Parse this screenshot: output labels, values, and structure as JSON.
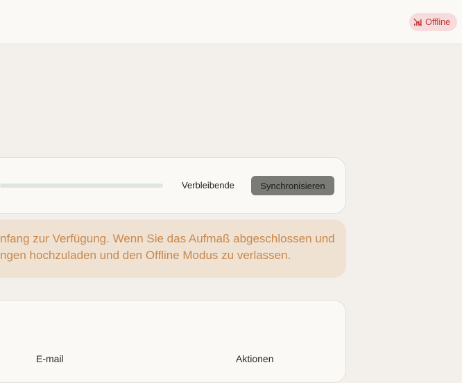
{
  "header": {
    "status_badge": {
      "label": "Offline",
      "icon": "signal-off-icon",
      "color": "#c23a35",
      "background": "#f6dcdc"
    }
  },
  "sync": {
    "progress_fraction": 0,
    "remaining_label": "Verbleibende",
    "sync_button_label": "Synchronisieren"
  },
  "notice": {
    "line1": "nfang zur Verfügung. Wenn Sie das Aufmaß abgeschlossen und",
    "line2": "ngen hochzuladen und den Offline Modus zu verlassen.",
    "text_color": "#c8874b",
    "background": "#efe2d3"
  },
  "table": {
    "columns": [
      "E-mail",
      "Aktionen"
    ]
  }
}
